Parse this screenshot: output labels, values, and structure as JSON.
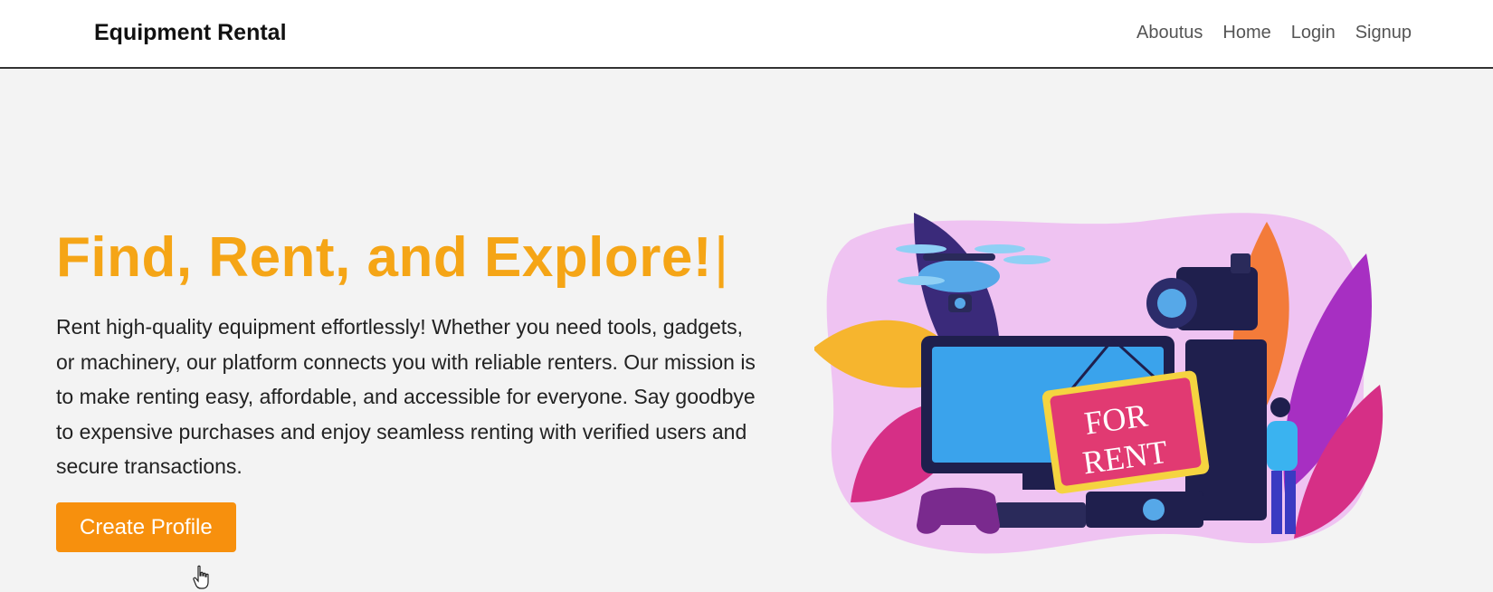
{
  "header": {
    "brand": "Equipment Rental",
    "nav": [
      "Aboutus",
      "Home",
      "Login",
      "Signup"
    ]
  },
  "hero": {
    "title": "Find, Rent, and Explore!",
    "caret": "|",
    "description": "Rent high-quality equipment effortlessly! Whether you need tools, gadgets, or machinery, our platform connects you with reliable renters. Our mission is to make renting easy, affordable, and accessible for everyone. Say goodbye to expensive purchases and enjoy seamless renting with verified users and secure transactions.",
    "cta_label": "Create Profile"
  },
  "illustration": {
    "sign_line1": "FOR",
    "sign_line2": "RENT"
  },
  "colors": {
    "accent": "#f5a516",
    "button": "#f7900d",
    "background": "#f3f3f3"
  }
}
